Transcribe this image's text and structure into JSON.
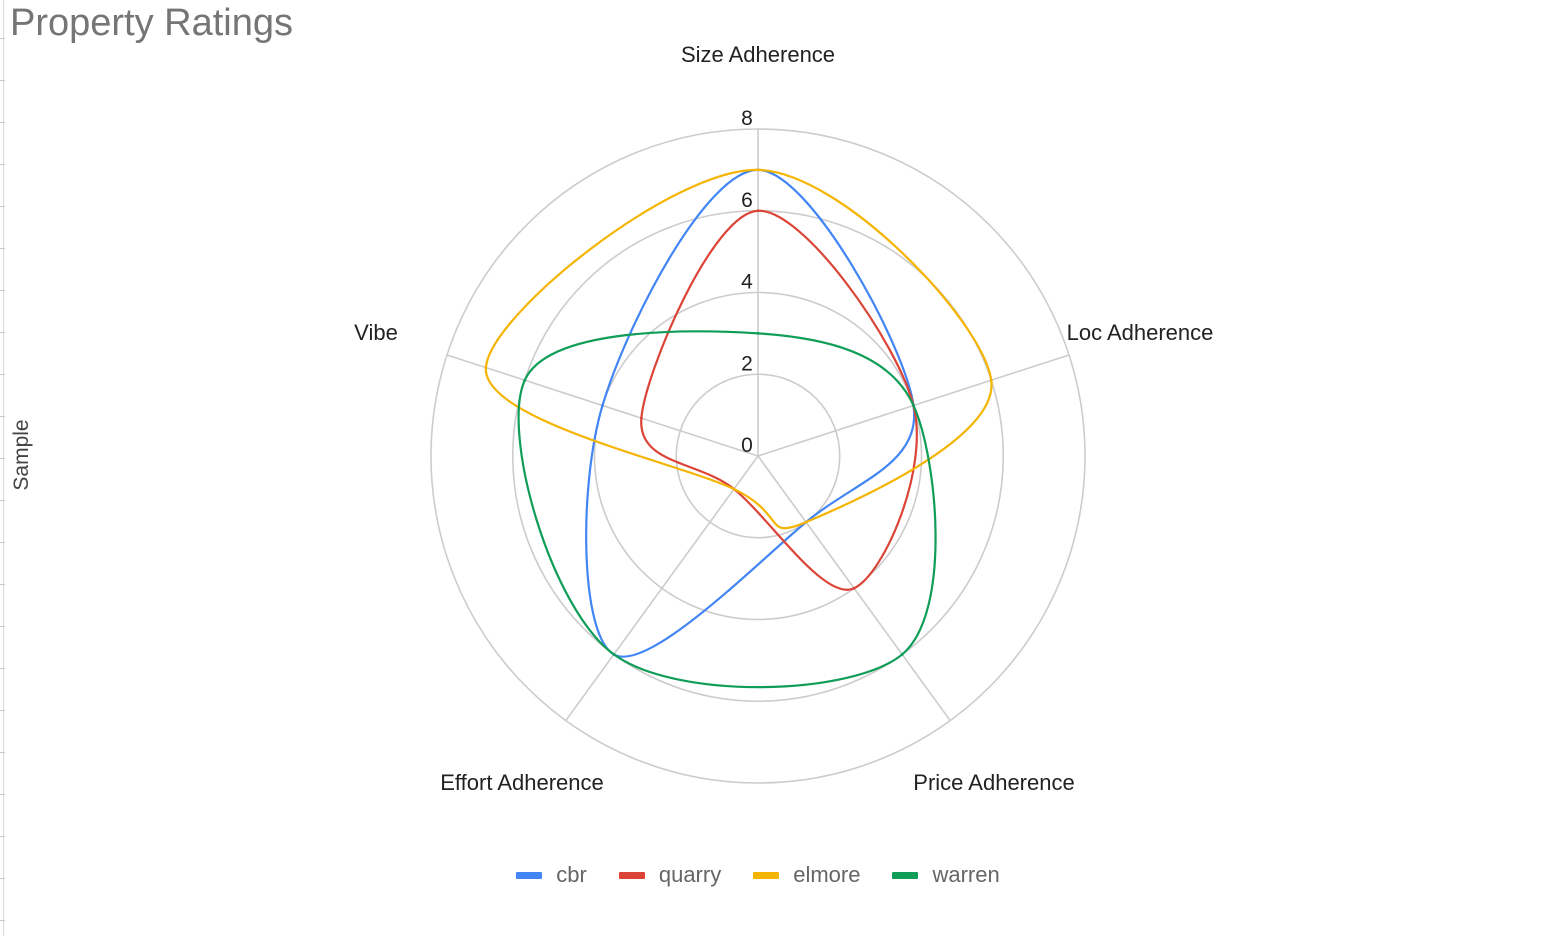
{
  "chart_data": {
    "type": "radar",
    "title": "Property Ratings",
    "side_label": "Sample",
    "axes": [
      "Size Adherence",
      "Loc Adherence",
      "Price Adherence",
      "Effort Adherence",
      "Vibe"
    ],
    "rlim": [
      0,
      8
    ],
    "ticks": [
      "0",
      "2",
      "4",
      "6",
      "8"
    ],
    "grid": true,
    "legend_position": "bottom",
    "series": [
      {
        "name": "cbr",
        "color": "#4285f4",
        "values": [
          7,
          4,
          2,
          6,
          4
        ]
      },
      {
        "name": "quarry",
        "color": "#db4437",
        "values": [
          6,
          4,
          4,
          1,
          3
        ]
      },
      {
        "name": "elmore",
        "color": "#f4b400",
        "values": [
          7,
          6,
          2,
          1,
          7
        ]
      },
      {
        "name": "warren",
        "color": "#0f9d58",
        "values": [
          3,
          4,
          6,
          6,
          6
        ]
      }
    ]
  }
}
